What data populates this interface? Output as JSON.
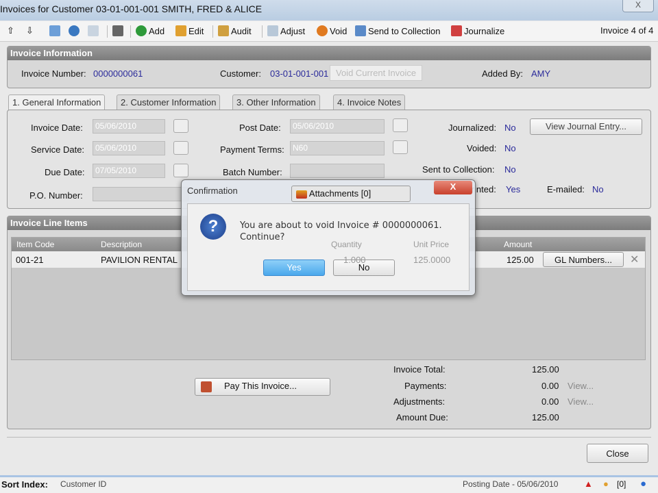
{
  "window": {
    "title": "Invoices for Customer 03-01-001-001  SMITH, FRED & ALICE",
    "close": "X"
  },
  "toolbar": {
    "add": "Add",
    "edit": "Edit",
    "audit": "Audit",
    "adjust": "Adjust",
    "void": "Void",
    "send": "Send to Collection",
    "journalize": "Journalize",
    "counter": "Invoice 4 of 4"
  },
  "info": {
    "title": "Invoice Information",
    "num_label": "Invoice Number:",
    "num": "0000000061",
    "cust_label": "Customer:",
    "cust": "03-01-001-001",
    "tooltip": "Void Current Invoice",
    "added_label": "Added By:",
    "added": "AMY"
  },
  "tabs": [
    "1. General Information",
    "2. Customer Information",
    "3. Other Information",
    "4. Invoice Notes"
  ],
  "general": {
    "inv_date_label": "Invoice Date:",
    "inv_date": "05/06/2010",
    "svc_date_label": "Service Date:",
    "svc_date": "05/06/2010",
    "due_date_label": "Due Date:",
    "due_date": "07/05/2010",
    "po_label": "P.O. Number:",
    "post_date_label": "Post Date:",
    "post_date": "05/06/2010",
    "terms_label": "Payment Terms:",
    "terms": "N60",
    "batch_label": "Batch Number:",
    "journalized_label": "Journalized:",
    "journalized": "No",
    "view_journal": "View Journal Entry...",
    "voided_label": "Voided:",
    "voided": "No",
    "sent_label": "Sent to Collection:",
    "sent": "No",
    "printed_label": "Printed:",
    "printed": "Yes",
    "emailed_label": "E-mailed:",
    "emailed": "No"
  },
  "lines": {
    "title": "Invoice Line Items",
    "headers": [
      "Item Code",
      "Description",
      "Quantity",
      "Unit Price",
      "Amount"
    ],
    "rows": [
      {
        "code": "001-21",
        "desc": "PAVILION RENTAL",
        "qty": "1.000",
        "price": "125.0000",
        "amount": "125.00",
        "gl": "GL Numbers..."
      }
    ]
  },
  "totals": {
    "pay_btn": "Pay This Invoice...",
    "total_label": "Invoice Total:",
    "total": "125.00",
    "payments_label": "Payments:",
    "payments": "0.00",
    "adj_label": "Adjustments:",
    "adj": "0.00",
    "due_label": "Amount Due:",
    "due": "125.00",
    "view": "View..."
  },
  "close": "Close",
  "status": {
    "sort_label": "Sort Index:",
    "sort": "Customer ID",
    "posting": "Posting Date - 05/06/2010",
    "alerts": "[0]"
  },
  "dialog": {
    "title": "Confirmation",
    "attachments": "Attachments [0]",
    "message": "You are about to void Invoice # 0000000061.",
    "message2": "Continue?",
    "yes": "Yes",
    "no": "No",
    "close": "X"
  }
}
